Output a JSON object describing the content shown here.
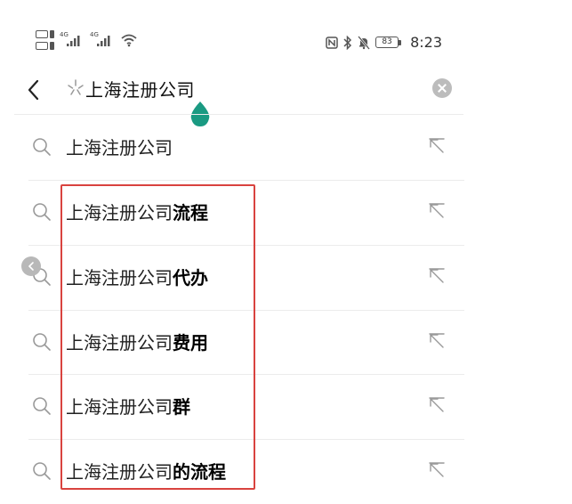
{
  "status_bar": {
    "sim1_tag": "4G",
    "sim2_tag": "4G",
    "battery_level": "83",
    "time": "8:23",
    "icons": [
      "sim-cards-icon",
      "signal-icon",
      "signal-icon",
      "wifi-icon",
      "nfc-icon",
      "bluetooth-icon",
      "mute-bell-icon",
      "battery-icon"
    ]
  },
  "search": {
    "query": "上海注册公司",
    "icons": [
      "back-arrow-icon",
      "sparkle-icon",
      "clear-icon"
    ],
    "accent_color": "#1a9a82"
  },
  "suggestions": [
    {
      "prefix": "上海注册公司",
      "suffix": ""
    },
    {
      "prefix": "上海注册公司",
      "suffix": "流程"
    },
    {
      "prefix": "上海注册公司",
      "suffix": "代办"
    },
    {
      "prefix": "上海注册公司",
      "suffix": "费用"
    },
    {
      "prefix": "上海注册公司",
      "suffix": "群"
    },
    {
      "prefix": "上海注册公司",
      "suffix": "的流程"
    }
  ],
  "annotation": {
    "highlight_color": "#d9433f"
  }
}
